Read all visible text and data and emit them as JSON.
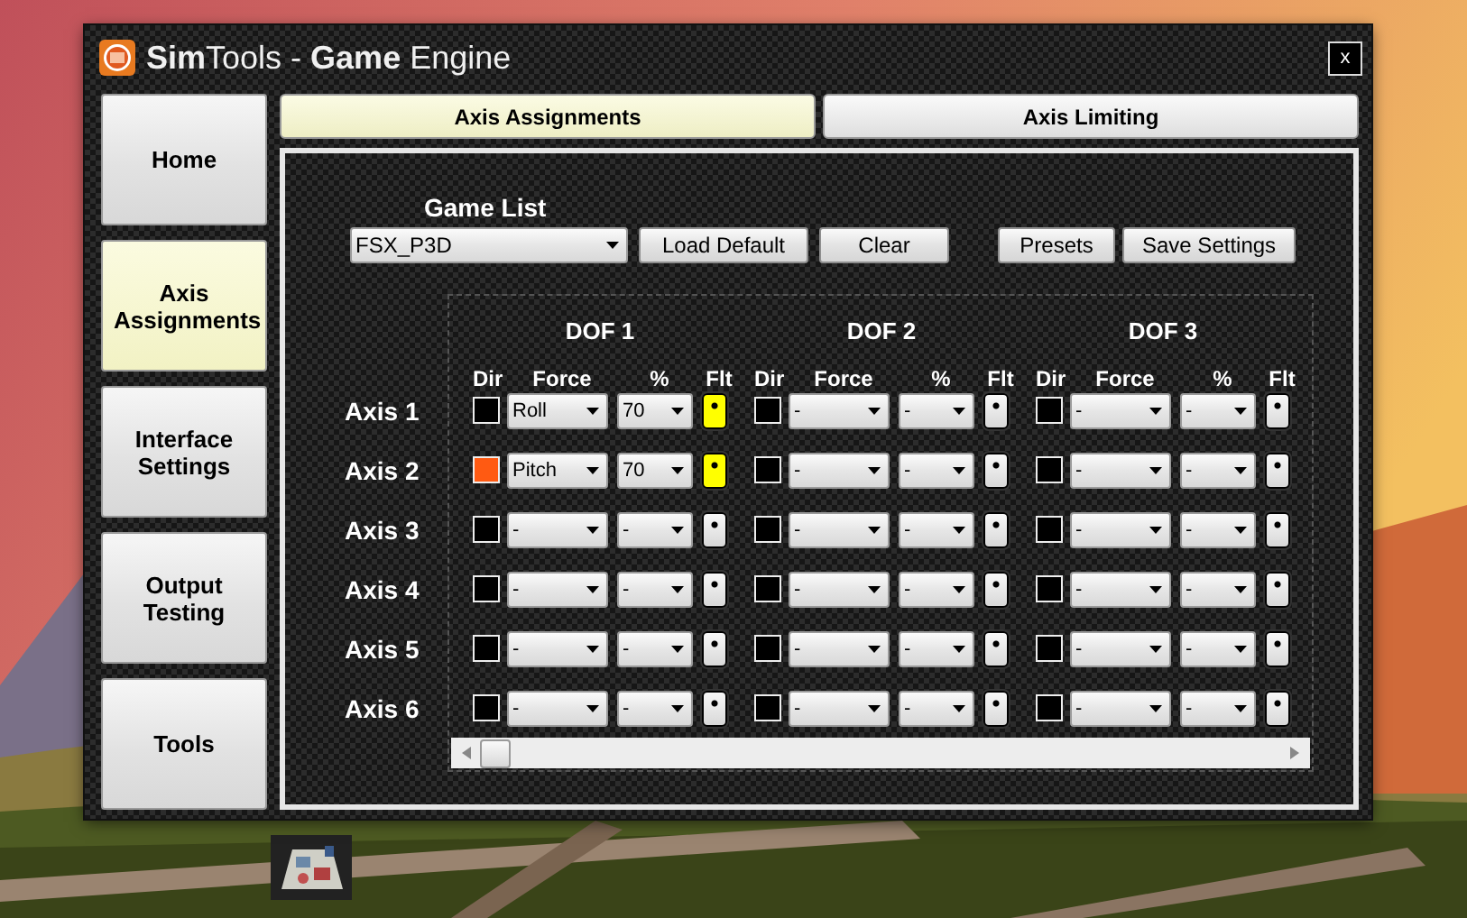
{
  "window": {
    "title": "**Sim**Tools - **Game** Engine",
    "close": "x"
  },
  "sidebar": {
    "items": [
      {
        "label": "Home",
        "selected": false
      },
      {
        "label": "Axis Assignments",
        "selected": true
      },
      {
        "label": "Interface Settings",
        "selected": false
      },
      {
        "label": "Output Testing",
        "selected": false
      },
      {
        "label": "Tools",
        "selected": false
      }
    ]
  },
  "tabs": [
    {
      "label": "Axis Assignments",
      "selected": true
    },
    {
      "label": "Axis Limiting",
      "selected": false
    }
  ],
  "game_list": {
    "label": "Game List",
    "value": "FSX_P3D"
  },
  "left_buttons": [
    "Load Default",
    "Clear"
  ],
  "right_buttons": [
    "Presets",
    "Save Settings"
  ],
  "dofs": [
    {
      "title": "DOF 1",
      "columns": [
        "Dir",
        "Force",
        "%",
        "Flt"
      ]
    },
    {
      "title": "DOF 2",
      "columns": [
        "Dir",
        "Force",
        "%",
        "Flt"
      ]
    },
    {
      "title": "DOF 3",
      "columns": [
        "Dir",
        "Force",
        "%",
        "Flt"
      ]
    }
  ],
  "rows": [
    {
      "label": "Axis 1",
      "cells": [
        {
          "dir_checked": false,
          "force": "Roll",
          "percent": "70",
          "filter_on": true
        },
        {
          "dir_checked": false,
          "force": "-",
          "percent": "-",
          "filter_on": false
        },
        {
          "dir_checked": false,
          "force": "-",
          "percent": "-",
          "filter_on": false
        }
      ]
    },
    {
      "label": "Axis 2",
      "cells": [
        {
          "dir_checked": true,
          "force": "Pitch",
          "percent": "70",
          "filter_on": true
        },
        {
          "dir_checked": false,
          "force": "-",
          "percent": "-",
          "filter_on": false
        },
        {
          "dir_checked": false,
          "force": "-",
          "percent": "-",
          "filter_on": false
        }
      ]
    },
    {
      "label": "Axis 3",
      "cells": [
        {
          "dir_checked": false,
          "force": "-",
          "percent": "-",
          "filter_on": false
        },
        {
          "dir_checked": false,
          "force": "-",
          "percent": "-",
          "filter_on": false
        },
        {
          "dir_checked": false,
          "force": "-",
          "percent": "-",
          "filter_on": false
        }
      ]
    },
    {
      "label": "Axis 4",
      "cells": [
        {
          "dir_checked": false,
          "force": "-",
          "percent": "-",
          "filter_on": false
        },
        {
          "dir_checked": false,
          "force": "-",
          "percent": "-",
          "filter_on": false
        },
        {
          "dir_checked": false,
          "force": "-",
          "percent": "-",
          "filter_on": false
        }
      ]
    },
    {
      "label": "Axis 5",
      "cells": [
        {
          "dir_checked": false,
          "force": "-",
          "percent": "-",
          "filter_on": false
        },
        {
          "dir_checked": false,
          "force": "-",
          "percent": "-",
          "filter_on": false
        },
        {
          "dir_checked": false,
          "force": "-",
          "percent": "-",
          "filter_on": false
        }
      ]
    },
    {
      "label": "Axis 6",
      "cells": [
        {
          "dir_checked": false,
          "force": "-",
          "percent": "-",
          "filter_on": false
        },
        {
          "dir_checked": false,
          "force": "-",
          "percent": "-",
          "filter_on": false
        },
        {
          "dir_checked": false,
          "force": "-",
          "percent": "-",
          "filter_on": false
        }
      ]
    }
  ]
}
